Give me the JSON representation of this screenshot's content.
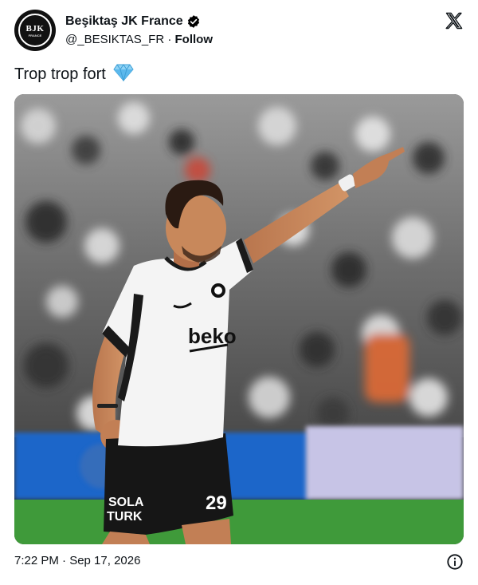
{
  "author": {
    "avatar_text": "BJK",
    "avatar_subtext": "FRANCE",
    "display_name": "Beşiktaş JK France",
    "handle": "@_BESIKTAS_FR",
    "separator": "·",
    "follow_label": "Follow",
    "verified": true
  },
  "tweet": {
    "text": "Trop trop fort",
    "emoji": "gem-icon",
    "timestamp": "7:22 PM · Sep 17, 2026"
  },
  "media": {
    "sponsor_text": "beko",
    "number": "29",
    "shorts_text_1": "SOLA",
    "shorts_text_2": "TURK"
  },
  "colors": {
    "text": "#0f1419",
    "verified_badge": "#000000",
    "pitch": "#3f9a3a"
  }
}
